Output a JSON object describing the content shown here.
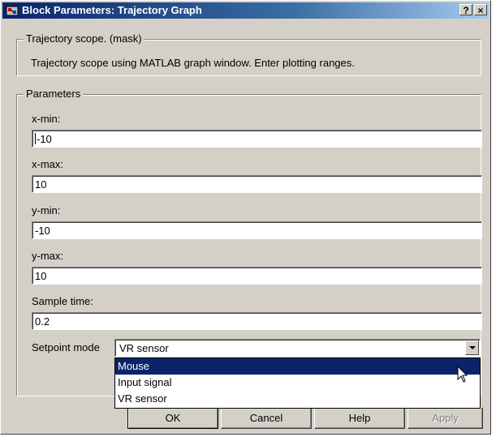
{
  "window": {
    "title": "Block Parameters: Trajectory Graph",
    "help_button": "?",
    "close_button": "×"
  },
  "mask": {
    "group_label": "Trajectory scope. (mask)",
    "description": "Trajectory scope using MATLAB graph window. Enter plotting ranges."
  },
  "parameters": {
    "group_label": "Parameters",
    "fields": [
      {
        "label": "x-min:",
        "value": "-10"
      },
      {
        "label": "x-max:",
        "value": "10"
      },
      {
        "label": "y-min:",
        "value": "-10"
      },
      {
        "label": "y-max:",
        "value": "10"
      },
      {
        "label": "Sample time:",
        "value": "0.2"
      }
    ],
    "setpoint": {
      "label": "Setpoint mode",
      "value": "VR sensor",
      "options": [
        "Mouse",
        "Input signal",
        "VR sensor"
      ],
      "highlighted": "Mouse"
    }
  },
  "buttons": {
    "ok": "OK",
    "cancel": "Cancel",
    "help": "Help",
    "apply": "Apply"
  },
  "colors": {
    "face": "#d4d0c8",
    "title_start": "#0a246a",
    "title_end": "#a6caf0",
    "selection": "#0a246a"
  }
}
